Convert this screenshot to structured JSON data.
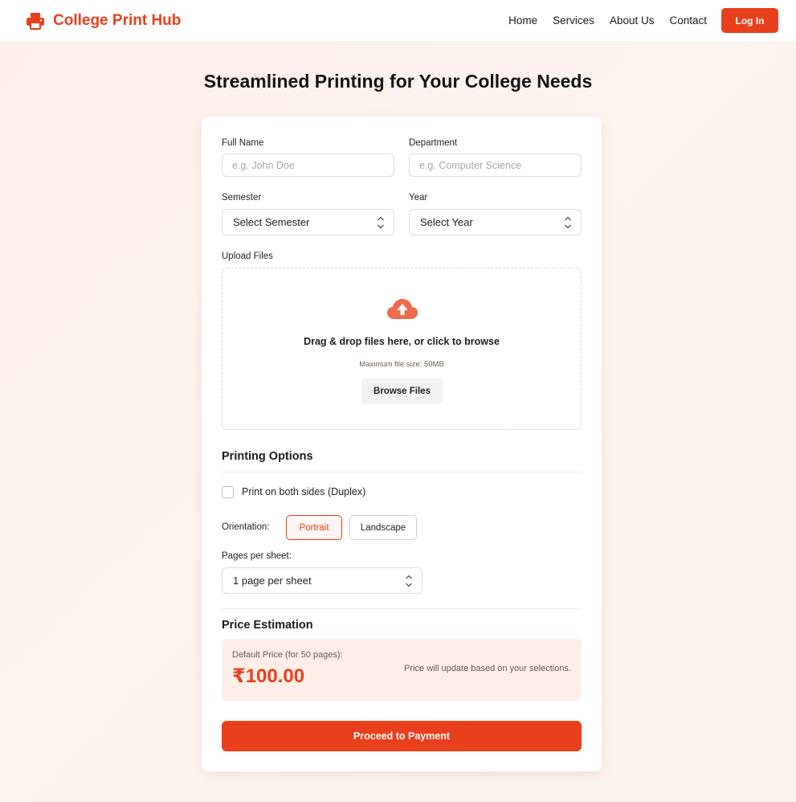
{
  "header": {
    "brand_name": "College Print Hub",
    "brand_icon": "printer-icon",
    "nav": [
      "Home",
      "Services",
      "About Us",
      "Contact"
    ],
    "login_label": "Log In"
  },
  "page_title": "Streamlined Printing for Your College Needs",
  "form": {
    "full_name": {
      "label": "Full Name",
      "placeholder": "e.g. John Doe",
      "value": ""
    },
    "department": {
      "label": "Department",
      "placeholder": "e.g. Computer Science",
      "value": ""
    },
    "semester": {
      "label": "Semester",
      "selected": "Select Semester"
    },
    "year": {
      "label": "Year",
      "selected": "Select Year"
    },
    "upload": {
      "label": "Upload Files",
      "icon": "cloud-upload-icon",
      "drop_text": "Drag & drop files here, or click to browse",
      "hint": "Maximum file size: 50MB",
      "browse_label": "Browse Files"
    }
  },
  "printing_options": {
    "title": "Printing Options",
    "duplex_label": "Print on both sides (Duplex)",
    "duplex_checked": false,
    "orientation_label": "Orientation:",
    "orientation_options": [
      "Portrait",
      "Landscape"
    ],
    "orientation_selected": "Portrait",
    "pages_per_sheet_label": "Pages per sheet:",
    "pages_per_sheet_selected": "1 page per sheet"
  },
  "price": {
    "title": "Price Estimation",
    "caption": "Default Price (for 50 pages):",
    "value": "₹100.00",
    "note": "Price will update based on your selections."
  },
  "submit_label": "Proceed to Payment",
  "colors": {
    "accent": "#e8401c",
    "accent_bg": "#fdeee8"
  }
}
